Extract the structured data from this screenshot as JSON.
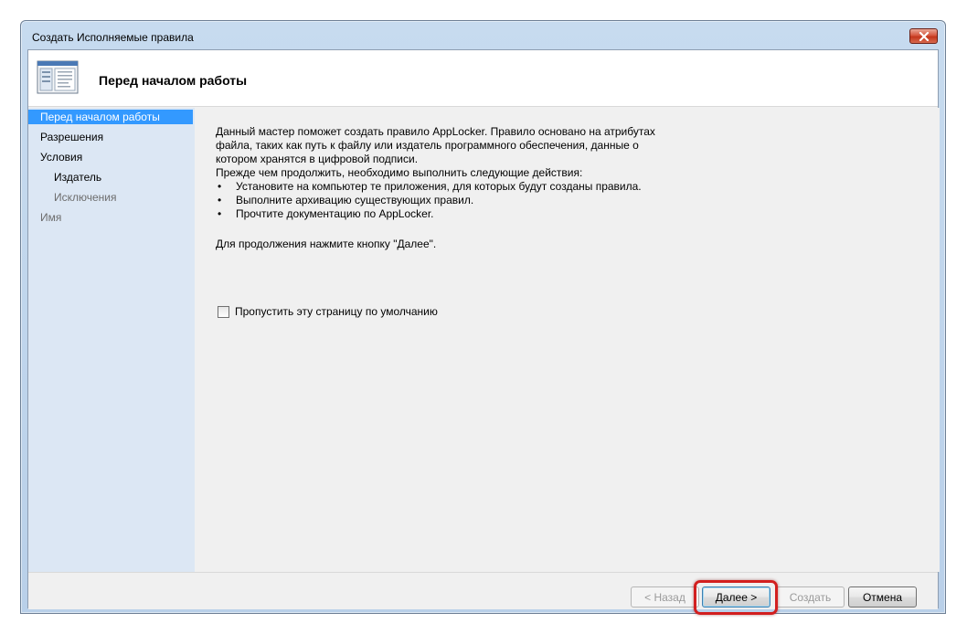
{
  "window": {
    "title": "Создать Исполняемые правила"
  },
  "header": {
    "title": "Перед началом работы",
    "icon": "wizard-form-icon"
  },
  "nav": {
    "items": [
      {
        "label": "Перед началом работы",
        "state": "selected"
      },
      {
        "label": "Разрешения",
        "state": "normal"
      },
      {
        "label": "Условия",
        "state": "normal"
      },
      {
        "label": "Издатель",
        "state": "normal"
      },
      {
        "label": "Исключения",
        "state": "disabled"
      },
      {
        "label": "Имя",
        "state": "disabled"
      }
    ]
  },
  "content": {
    "intro_lines": [
      "Данный мастер поможет создать правило AppLocker. Правило основано на атрибутах",
      "файла, таких как путь к файлу или издатель программного обеспечения, данные о",
      "котором хранятся в цифровой подписи.",
      "Прежде чем продолжить, необходимо выполнить следующие действия:"
    ],
    "bullets": [
      "Установите на компьютер те приложения, для которых будут созданы правила.",
      "Выполните архивацию существующих правил.",
      "Прочтите документацию по AppLocker."
    ],
    "continue_text": "Для продолжения нажмите кнопку \"Далее\".",
    "skip_checkbox_label": "Пропустить эту страницу по умолчанию",
    "skip_checked": false
  },
  "footer": {
    "back_label": "< Назад",
    "next_label": "Далее >",
    "create_label": "Создать",
    "cancel_label": "Отмена"
  },
  "colors": {
    "selection": "#3399ff",
    "nav_bg": "#dce7f4",
    "highlight": "#d21f1f"
  }
}
